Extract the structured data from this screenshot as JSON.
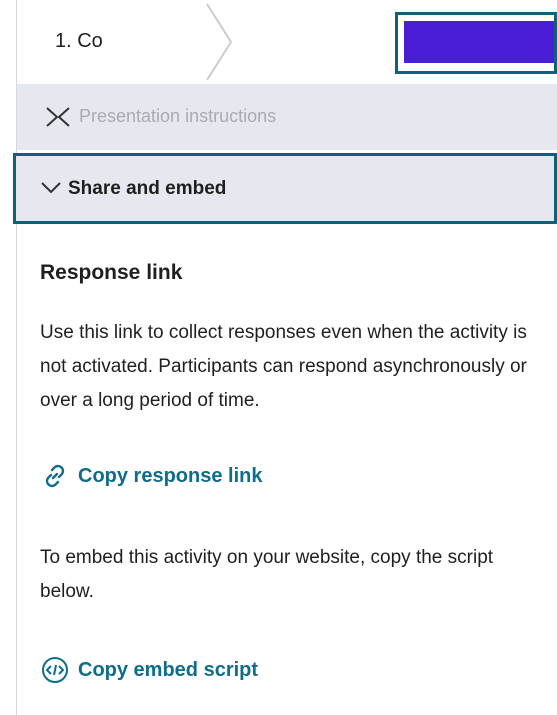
{
  "breadcrumb": {
    "step_1_label": "1. Co",
    "step_2_label": ""
  },
  "accordion": {
    "collapsed_label": "Presentation instructions",
    "share_label": "Share and embed"
  },
  "response": {
    "title": "Response link",
    "description": "Use this link to collect responses even when the activity is not activated. Participants can respond asynchronously or over a long period of time.",
    "copy_link_label": "Copy response link"
  },
  "embed": {
    "description": "To embed this activity on your website, copy the script below.",
    "copy_script_label": "Copy embed script"
  },
  "colors": {
    "accent": "#0f6d8c",
    "focus_border": "#10607a",
    "panel_bg": "#e6e8ef"
  },
  "icons": {
    "collapse": "chevron-right-icon",
    "expand": "chevron-down-icon",
    "link": "link-icon",
    "embed": "code-icon"
  }
}
